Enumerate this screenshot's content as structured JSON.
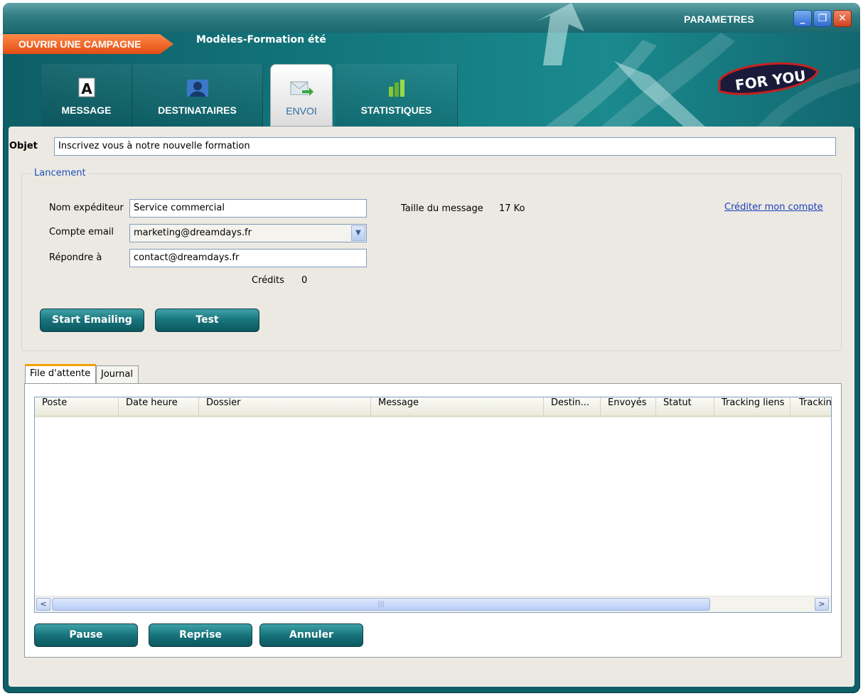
{
  "window": {
    "parametres_label": "PARAMETRES",
    "minimize_glyph": "_",
    "restore_glyph": "❐",
    "close_glyph": "✕"
  },
  "campaign": {
    "open_label": "OUVRIR UNE CAMPAGNE",
    "name": "Modèles-Formation été"
  },
  "nav_tabs": [
    {
      "label": "MESSAGE",
      "icon": "letter-a-icon"
    },
    {
      "label": "DESTINATAIRES",
      "icon": "contacts-icon"
    },
    {
      "label": "ENVOI",
      "icon": "send-mail-icon",
      "active": true
    },
    {
      "label": "STATISTIQUES",
      "icon": "stats-icon"
    }
  ],
  "logo_text": "FOR YOU",
  "objet": {
    "label": "Objet",
    "value": "Inscrivez vous à notre nouvelle formation"
  },
  "lancement": {
    "legend": "Lancement",
    "sender_label": "Nom expéditeur",
    "sender_value": "Service commercial",
    "account_label": "Compte email",
    "account_value": "marketing@dreamdays.fr",
    "reply_label": "Répondre à",
    "reply_value": "contact@dreamdays.fr",
    "credits_label": "Crédits",
    "credits_value": "0",
    "size_label": "Taille du message",
    "size_value": "17 Ko",
    "credit_link": "Créditer mon compte",
    "start_button": "Start Emailing",
    "test_button": "Test"
  },
  "sub_tabs": [
    "File d'attente",
    "Journal"
  ],
  "queue_columns": [
    "Poste",
    "Date heure",
    "Dossier",
    "Message",
    "Destin...",
    "Envoyés",
    "Statut",
    "Tracking liens",
    "Trackin"
  ],
  "scroll": {
    "left": "<",
    "right": ">",
    "grip": "|||"
  },
  "bottom_buttons": {
    "pause": "Pause",
    "reprise": "Reprise",
    "annuler": "Annuler"
  },
  "colors": {
    "header_teal": "#0f5f68",
    "orange_tab": "#e24d12",
    "button_teal": "#17737b",
    "link_blue": "#1d3fb8"
  }
}
